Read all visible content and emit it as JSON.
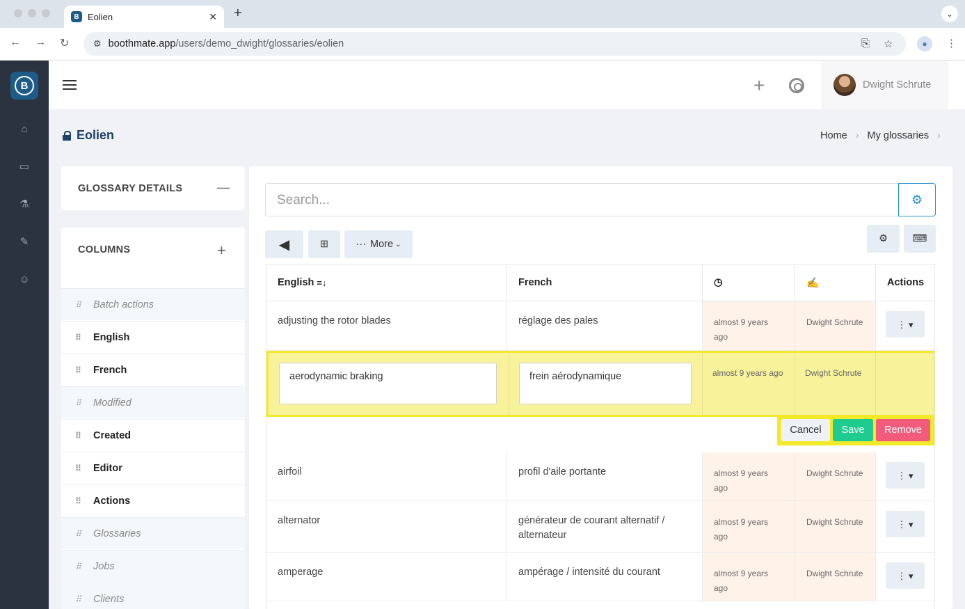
{
  "browser": {
    "tab_title": "Eolien",
    "url_host": "boothmate.app",
    "url_path": "/users/demo_dwight/glossaries/eolien"
  },
  "header": {
    "user_name": "Dwight Schrute"
  },
  "page": {
    "title": "Eolien",
    "breadcrumb": [
      "Home",
      "My glossaries"
    ]
  },
  "panels": {
    "details_title": "GLOSSARY DETAILS",
    "columns_title": "COLUMNS",
    "columns": [
      {
        "label": "Batch actions",
        "enabled": false
      },
      {
        "label": "English",
        "enabled": true
      },
      {
        "label": "French",
        "enabled": true
      },
      {
        "label": "Modified",
        "enabled": false
      },
      {
        "label": "Created",
        "enabled": true
      },
      {
        "label": "Editor",
        "enabled": true
      },
      {
        "label": "Actions",
        "enabled": true
      },
      {
        "label": "Glossaries",
        "enabled": false
      },
      {
        "label": "Jobs",
        "enabled": false
      },
      {
        "label": "Clients",
        "enabled": false
      }
    ]
  },
  "toolbar": {
    "search_placeholder": "Search...",
    "more_label": "More"
  },
  "table": {
    "headers": [
      "English",
      "French",
      "",
      "",
      "Actions"
    ],
    "sort_indicator": "=↓",
    "rows": [
      {
        "english": "adjusting the rotor blades",
        "french": "réglage des pales",
        "created": "almost 9 years ago",
        "editor": "Dwight Schrute"
      },
      {
        "english": "aerodynamic braking",
        "french": "frein aérodynamique",
        "created": "almost 9 years ago",
        "editor": "Dwight Schrute",
        "editing": true
      },
      {
        "english": "airfoil",
        "french": "profil d'aile portante",
        "created": "almost 9 years ago",
        "editor": "Dwight Schrute"
      },
      {
        "english": "alternator",
        "french": "générateur de courant alternatif / alternateur",
        "created": "almost 9 years ago",
        "editor": "Dwight Schrute"
      },
      {
        "english": "amperage",
        "french": "ampérage / intensité du courant",
        "created": "almost 9 years ago",
        "editor": "Dwight Schrute"
      }
    ],
    "edit_actions": {
      "cancel": "Cancel",
      "save": "Save",
      "remove": "Remove"
    }
  },
  "colors": {
    "sidebar": "#2c3340",
    "brand": "#1d5c89",
    "save": "#1fcc8f",
    "remove": "#f35b7d",
    "edit_highlight": "#f2e928"
  }
}
